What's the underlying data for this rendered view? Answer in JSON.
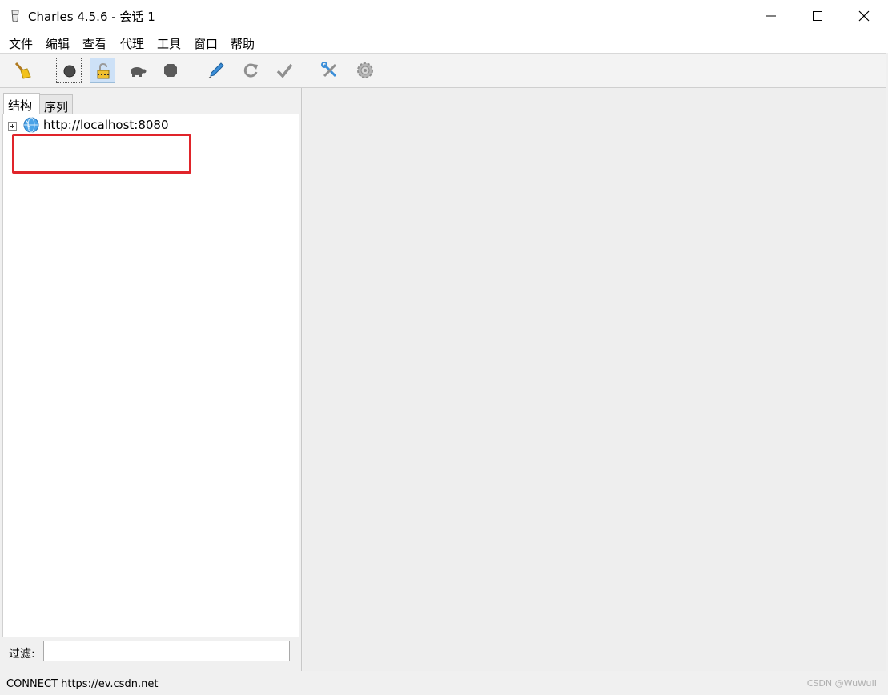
{
  "window": {
    "title": "Charles 4.5.6 - 会话 1"
  },
  "menu": [
    "文件",
    "编辑",
    "查看",
    "代理",
    "工具",
    "窗口",
    "帮助"
  ],
  "toolbar": {
    "icons": [
      "broom-icon",
      "record-icon",
      "ssl-proxy-lock-icon",
      "throttle-turtle-icon",
      "breakpoint-icon",
      "compose-pen-icon",
      "repeat-icon",
      "validate-check-icon",
      "tools-icon",
      "settings-gear-icon"
    ]
  },
  "left_panel": {
    "tabs": [
      "结构",
      "序列"
    ],
    "tree": [
      {
        "label": "http://localhost:8080"
      }
    ],
    "filter_label": "过滤:",
    "filter_value": ""
  },
  "status": {
    "text": "CONNECT https://ev.csdn.net",
    "watermark": "CSDN @WuWuII"
  },
  "colors": {
    "highlight": "#e0242a",
    "selected_tool": "#cde1f7"
  }
}
